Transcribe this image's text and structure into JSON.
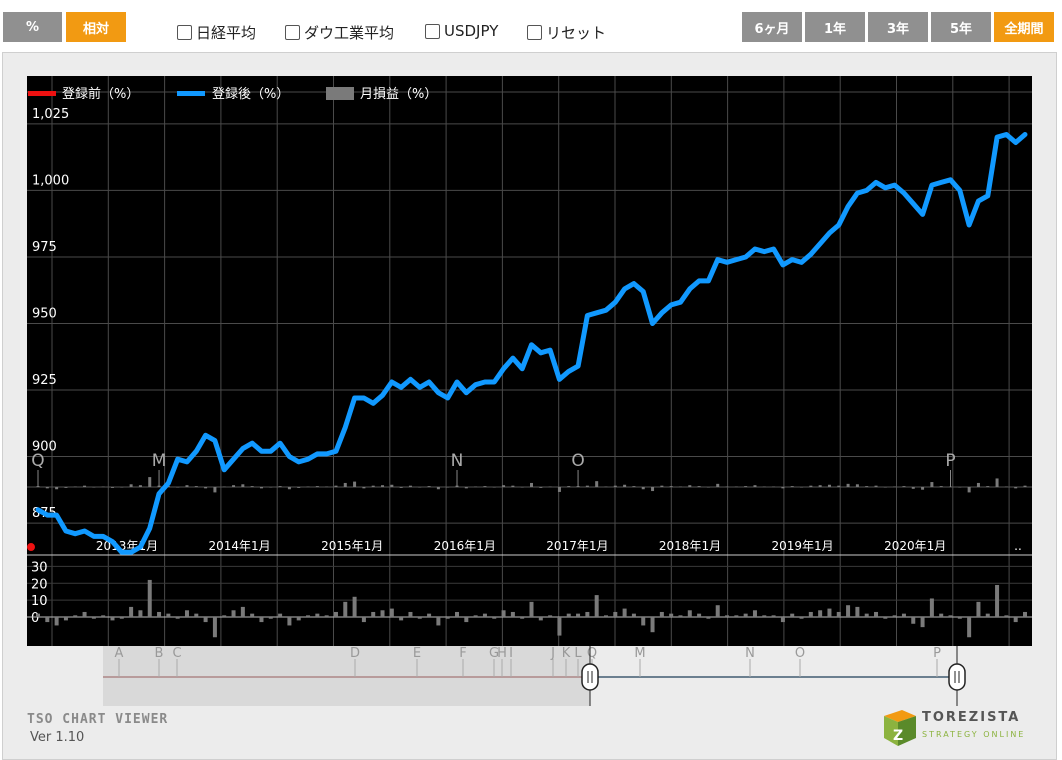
{
  "toolbar": {
    "mode_percent": "%",
    "mode_relative": "相対",
    "checkboxes": [
      "日経平均",
      "ダウ工業平均",
      "USDJPY",
      "リセット"
    ],
    "periods": [
      "6ヶ月",
      "1年",
      "3年",
      "5年",
      "全期間"
    ],
    "active_period": "全期間",
    "active_mode": "相対"
  },
  "legend": {
    "before": "登録前（%）",
    "after": "登録後（%）",
    "monthly": "月損益（%）"
  },
  "colors": {
    "before": "#ee1111",
    "after": "#1199ff",
    "monthly": "#7a7a7a",
    "accent": "#f29a12",
    "inactive": "#909090"
  },
  "chart_data": {
    "type": "line",
    "series": [
      {
        "name": "登録前（%）",
        "values": [
          866
        ]
      },
      {
        "name": "登録後（%）",
        "values": [
          880,
          878,
          878,
          872,
          871,
          872,
          870,
          870,
          868,
          864,
          864,
          866,
          873,
          886,
          890,
          899,
          898,
          902,
          908,
          906,
          895,
          899,
          903,
          905,
          902,
          902,
          905,
          900,
          898,
          899,
          901,
          901,
          902,
          911,
          922,
          922,
          920,
          923,
          928,
          926,
          929,
          926,
          928,
          924,
          922,
          928,
          924,
          927,
          928,
          928,
          933,
          937,
          933,
          942,
          939,
          940,
          929,
          932,
          934,
          953,
          954,
          955,
          958,
          963,
          965,
          962,
          950,
          954,
          957,
          958,
          963,
          966,
          966,
          974,
          973,
          974,
          975,
          978,
          977,
          978,
          972,
          974,
          973,
          976,
          980,
          984,
          987,
          994,
          999,
          1000,
          1003,
          1001,
          1002,
          999,
          995,
          991,
          1002,
          1003,
          1004,
          1000,
          987,
          996,
          998,
          1020,
          1021,
          1018,
          1021
        ]
      }
    ],
    "y_ticks": [
      "875",
      "900",
      "925",
      "950",
      "975",
      "1,000",
      "1,025"
    ],
    "ylim": [
      863,
      1043
    ],
    "x_tick_labels": [
      "2013年1月",
      "2014年1月",
      "2015年1月",
      "2016年1月",
      "2017年1月",
      "2018年1月",
      "2019年1月",
      "2020年1月"
    ],
    "event_markers": [
      "Q",
      "M",
      "N",
      "O",
      "P"
    ],
    "monthly": {
      "values": [
        2,
        -3,
        -5,
        -2,
        1,
        3,
        -1,
        1,
        -2,
        -1,
        6,
        4,
        22,
        3,
        2,
        -1,
        4,
        2,
        -3,
        -12,
        1,
        4,
        6,
        2,
        -3,
        -1,
        2,
        -5,
        -2,
        1,
        2,
        1,
        3,
        9,
        12,
        -3,
        3,
        4,
        5,
        -2,
        3,
        -1,
        2,
        -5,
        -1,
        3,
        -3,
        1,
        2,
        -1,
        4,
        3,
        -1,
        9,
        -2,
        1,
        -11,
        2,
        2,
        3,
        13,
        1,
        3,
        5,
        2,
        -5,
        -9,
        3,
        2,
        1,
        4,
        2,
        -1,
        7,
        1,
        1,
        2,
        4,
        1,
        1,
        -3,
        2,
        -1,
        3,
        4,
        5,
        3,
        7,
        6,
        2,
        3,
        -1,
        1,
        2,
        -4,
        -6,
        11,
        2,
        1,
        -1,
        -12,
        9,
        2,
        19,
        1,
        -3,
        3
      ],
      "y_ticks": [
        "0",
        "10",
        "20",
        "30"
      ],
      "ylim": [
        -16,
        35
      ]
    },
    "navigator_markers": [
      "A",
      "B",
      "C",
      "D",
      "E",
      "F",
      "G",
      "H",
      "I",
      "J",
      "K",
      "L",
      "Q",
      "M",
      "N",
      "O",
      "P"
    ]
  },
  "footer": {
    "title": "TSO CHART VIEWER",
    "version": "Ver 1.10",
    "logo_name": "TOREZISTA",
    "logo_tag": "STRATEGY ONLINE"
  }
}
